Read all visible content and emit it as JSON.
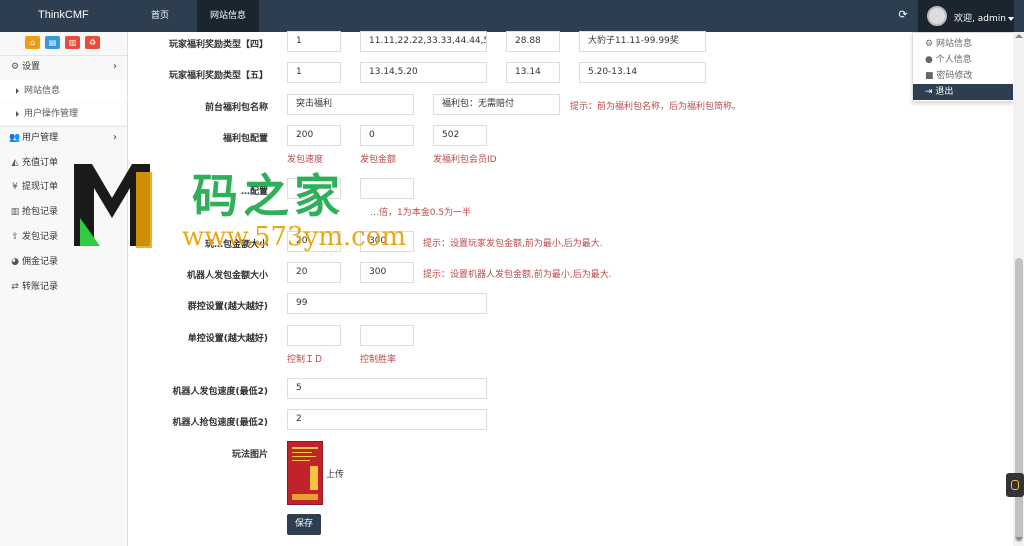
{
  "topbar": {
    "brand": "ThinkCMF",
    "nav": [
      {
        "label": "首页"
      },
      {
        "label": "网站信息"
      }
    ],
    "user": {
      "welcome": "欢迎, admin"
    },
    "dropdown": [
      {
        "label": "网站信息"
      },
      {
        "label": "个人信息"
      },
      {
        "label": "密码修改"
      },
      {
        "label": "退出"
      }
    ]
  },
  "sidebar": {
    "items": [
      {
        "label": "设置",
        "icon": "cogs-icon"
      },
      {
        "label": "网站信息"
      },
      {
        "label": "用户操作管理"
      },
      {
        "label": "用户管理",
        "icon": "users-icon"
      },
      {
        "label": "充值订单",
        "icon": "area-chart-icon"
      },
      {
        "label": "提现订单",
        "icon": "yen-icon"
      },
      {
        "label": "抢包记录",
        "icon": "bar-chart-icon"
      },
      {
        "label": "发包记录",
        "icon": "upload-icon"
      },
      {
        "label": "佣金记录",
        "icon": "pie-chart-icon"
      },
      {
        "label": "转账记录",
        "icon": "exchange-icon"
      }
    ]
  },
  "form": {
    "row4": {
      "label": "玩家福利奖励类型【四】",
      "v1": "1",
      "v2": "11.11,22.22,33.33,44.44,55.",
      "v3": "28.88",
      "v4": "大豹子11.11-99.99奖"
    },
    "row5": {
      "label": "玩家福利奖励类型【五】",
      "v1": "1",
      "v2": "13.14,5.20",
      "v3": "13.14",
      "v4": "5.20-13.14"
    },
    "front": {
      "label": "前台福利包名称",
      "v1": "突击福利",
      "v2": "福利包：无需赔付",
      "hint": "提示：前为福利包名称，后为福利包简称。"
    },
    "packet": {
      "label": "福利包配置",
      "v1": "200",
      "v2": "0",
      "v3": "502",
      "cap1": "发包速度",
      "cap2": "发包金额",
      "cap3": "发福利包会员ID"
    },
    "payout": {
      "label": "…配置",
      "cap2": "…倍，1为本金0.5为一半"
    },
    "player_amount": {
      "label": "玩…包金额大小",
      "v1": "20",
      "v2": "300",
      "hint": "提示：设置玩家发包金额,前为最小,后为最大."
    },
    "robot_amount": {
      "label": "机器人发包金额大小",
      "v1": "20",
      "v2": "300",
      "hint": "提示：设置机器人发包金额,前为最小,后为最大."
    },
    "group_ctrl": {
      "label": "群控设置(越大越好)",
      "v1": "99"
    },
    "single_ctrl": {
      "label": "单控设置(越大越好)",
      "cap1": "控制ＩＤ",
      "cap2": "控制胜率"
    },
    "robot_send": {
      "label": "机器人发包速度(最低2)",
      "v1": "5"
    },
    "robot_grab": {
      "label": "机器人抢包速度(最低2)",
      "v1": "2"
    },
    "image": {
      "label": "玩法图片",
      "upload": "上传"
    },
    "save": "保存"
  },
  "watermark": {
    "text": "码之家",
    "url": "www.573ym.com"
  },
  "colors": {
    "topbar": "#2c3e50",
    "hint": "#b94a48",
    "watermark_green": "#1ea94b",
    "watermark_orange": "#e8a30c"
  }
}
